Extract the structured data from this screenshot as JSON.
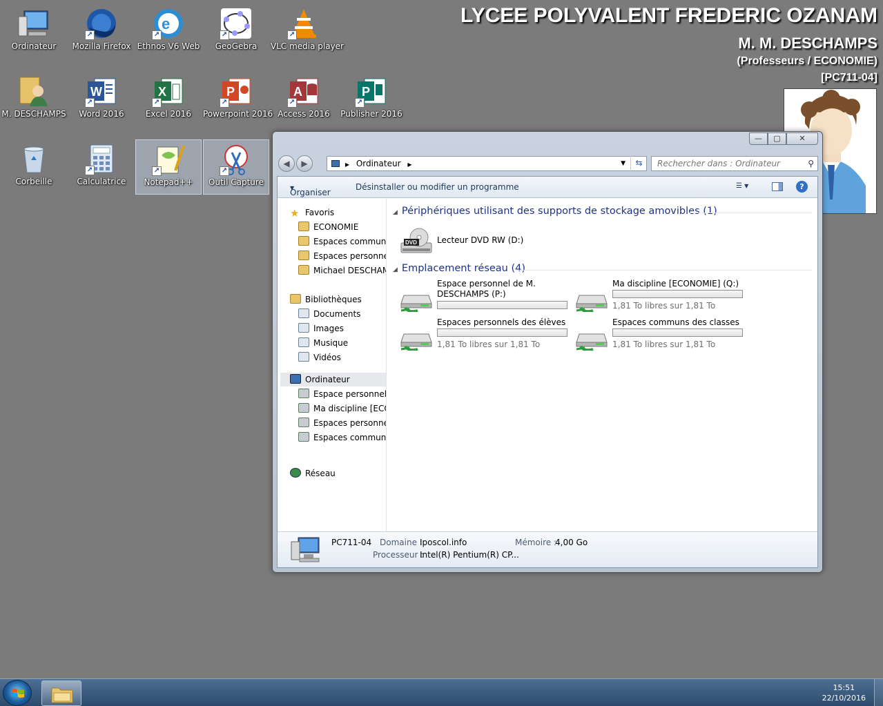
{
  "desktop": {
    "icons": [
      {
        "label": "Ordinateur",
        "icon": "computer-icon"
      },
      {
        "label": "Mozilla Firefox",
        "icon": "firefox-icon"
      },
      {
        "label": "Ethnos V6 Web",
        "icon": "ethnos-icon"
      },
      {
        "label": "GeoGebra",
        "icon": "geogebra-icon"
      },
      {
        "label": "VLC media player",
        "icon": "vlc-icon"
      },
      {
        "label": "M. DESCHAMPS",
        "icon": "user-folder-icon"
      },
      {
        "label": "Word 2016",
        "icon": "word-icon"
      },
      {
        "label": "Excel 2016",
        "icon": "excel-icon"
      },
      {
        "label": "Powerpoint 2016",
        "icon": "powerpoint-icon"
      },
      {
        "label": "Access 2016",
        "icon": "access-icon"
      },
      {
        "label": "Publisher 2016",
        "icon": "publisher-icon"
      },
      {
        "label": "Corbeille",
        "icon": "recycle-bin-icon"
      },
      {
        "label": "Calculatrice",
        "icon": "calculator-icon"
      },
      {
        "label": "Notepad++",
        "icon": "notepadpp-icon"
      },
      {
        "label": "Outil Capture",
        "icon": "snipping-tool-icon"
      }
    ]
  },
  "banner": {
    "school": "LYCEE POLYVALENT FREDERIC OZANAM",
    "user": "M. M. DESCHAMPS",
    "group": "(Professeurs / ECONOMIE)",
    "pc": "[PC711-04]"
  },
  "window": {
    "caption_buttons": {
      "minimize": "—",
      "maximize": "▢",
      "close": "✕"
    },
    "address": "Ordinateur",
    "search_placeholder": "Rechercher dans : Ordinateur",
    "toolbar": {
      "organize": "Organiser",
      "uninstall": "Désinstaller ou modifier un programme"
    },
    "nav": {
      "favorites": "Favoris",
      "favorites_items": [
        "ECONOMIE",
        "Espaces communs d",
        "Espaces personnels d",
        "Michael DESCHAMP"
      ],
      "libraries": "Bibliothèques",
      "libraries_items": [
        "Documents",
        "Images",
        "Musique",
        "Vidéos"
      ],
      "computer": "Ordinateur",
      "computer_items": [
        "Espace personnel de",
        "Ma discipline [ECON",
        "Espaces personnels d",
        "Espaces communs d"
      ],
      "network": "Réseau"
    },
    "groups": {
      "removable": "Périphériques utilisant des supports de stockage amovibles (1)",
      "network": "Emplacement réseau (4)"
    },
    "dvd": {
      "name": "Lecteur DVD RW (D:)",
      "badge": "DVD"
    },
    "net_drives": [
      {
        "name": "Espace personnel de M. DESCHAMPS (P:)",
        "size": "",
        "fill": 0
      },
      {
        "name": "Ma discipline [ECONOMIE] (Q:)",
        "size": "1,81 To libres sur 1,81 To",
        "fill": 0
      },
      {
        "name": "Espaces personnels des élèves (R:)",
        "size": "1,81 To libres sur 1,81 To",
        "fill": 0
      },
      {
        "name": "Espaces communs des classes (S:)",
        "size": "1,81 To libres sur 1,81 To",
        "fill": 0
      }
    ],
    "details": {
      "pc_name": "PC711-04",
      "domain_label": "Domaine :",
      "domain_value": "Iposcol.info",
      "memory_label": "Mémoire :",
      "memory_value": "4,00 Go",
      "cpu_label": "Processeur :",
      "cpu_value": "Intel(R) Pentium(R) CP..."
    }
  },
  "taskbar": {
    "time": "15:51",
    "date": "22/10/2016"
  },
  "colors": {
    "desktop": "#7b7b7b",
    "group_header": "#1e3287",
    "taskbar": "#2c4a6c"
  }
}
